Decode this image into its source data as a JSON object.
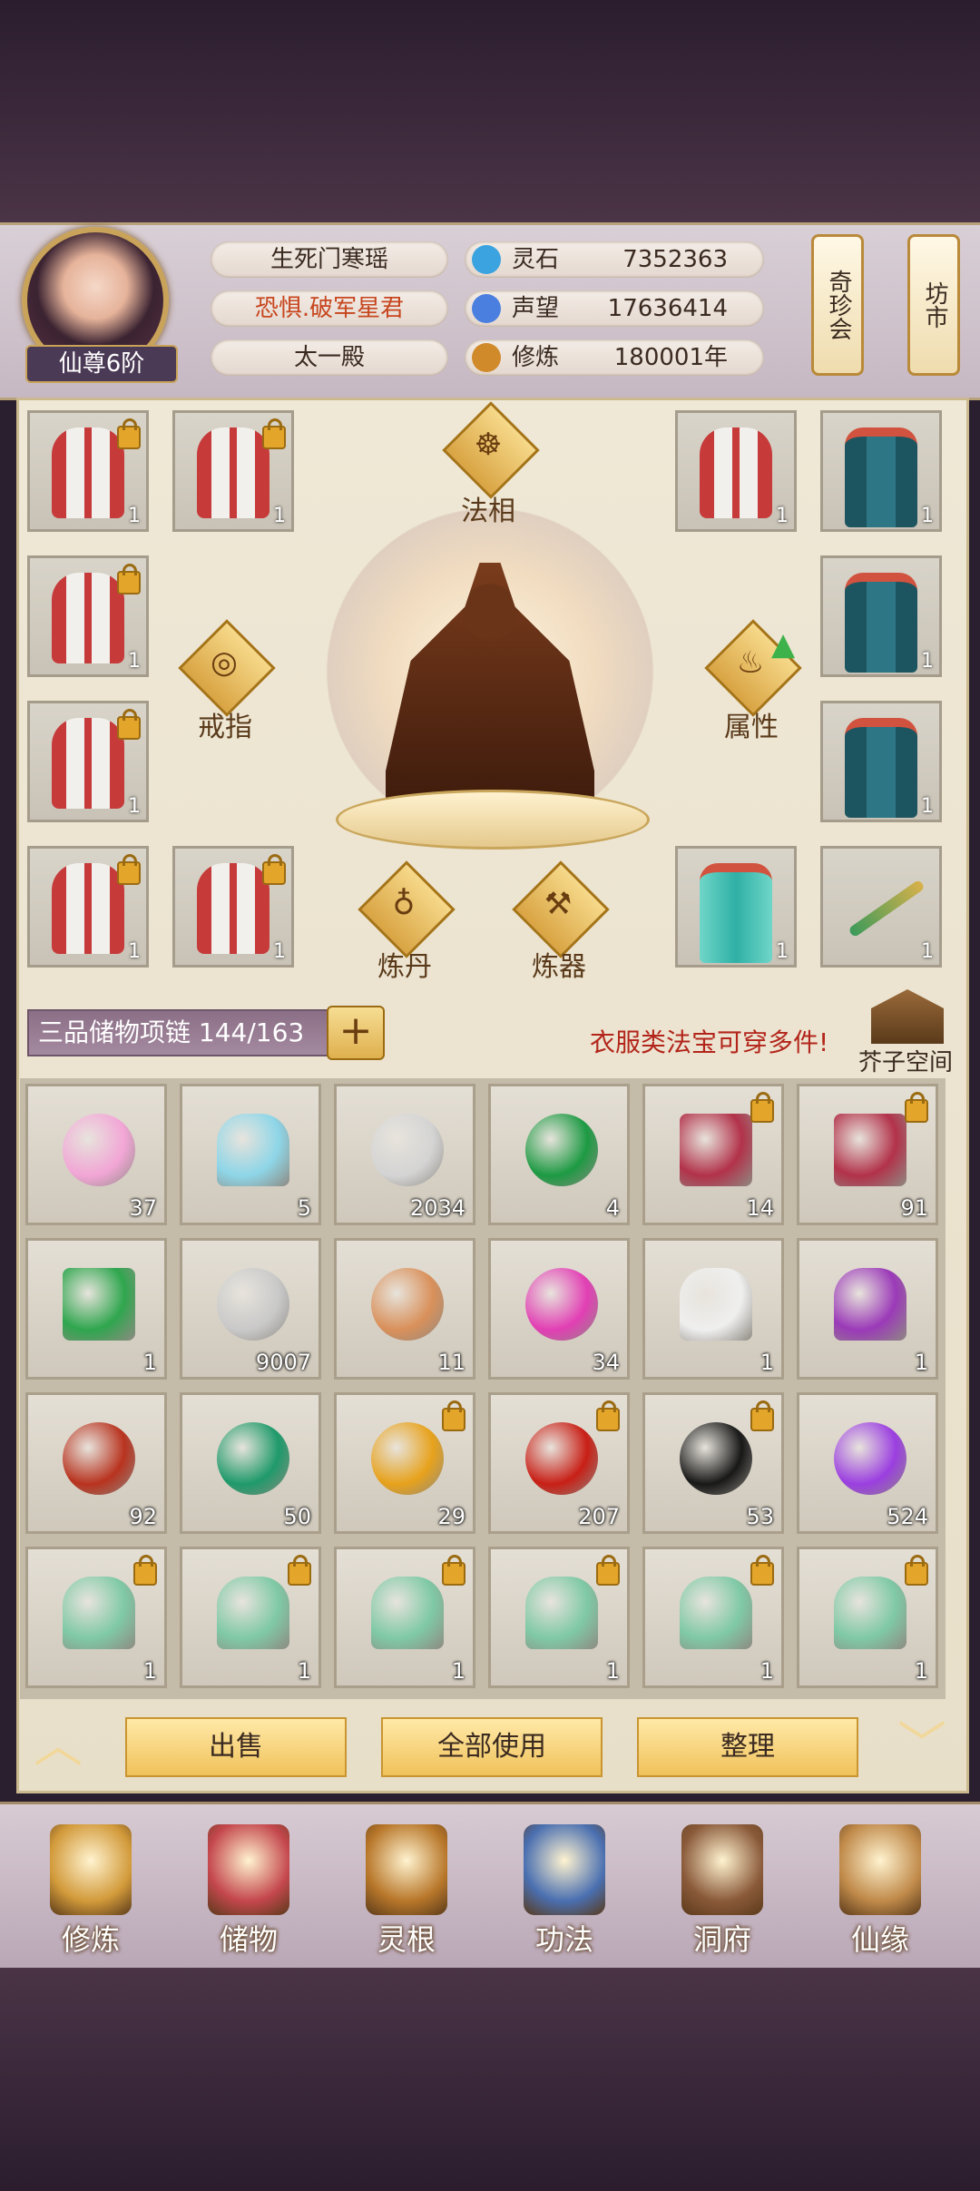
{
  "header": {
    "rank": "仙尊6阶",
    "info_pills": [
      "生死门寒瑶",
      "恐惧.破军星君",
      "太一殿"
    ],
    "stats": [
      {
        "label": "灵石",
        "value": "7352363",
        "icon": "spirit-stone-icon",
        "color": "#3aa3e0"
      },
      {
        "label": "声望",
        "value": "17636414",
        "icon": "reputation-icon",
        "color": "#4a7fe0"
      },
      {
        "label": "修炼",
        "value": "180001年",
        "icon": "meditation-icon",
        "color": "#d08a2a"
      }
    ],
    "side_buttons": [
      "奇珍会",
      "坊市"
    ]
  },
  "equipment": {
    "slots_left": [
      {
        "type": "robe-red",
        "qty": "1",
        "locked": true
      },
      {
        "type": "robe-red",
        "qty": "1",
        "locked": true
      },
      {
        "type": "robe-red",
        "qty": "1",
        "locked": true
      },
      {
        "type": "robe-red",
        "qty": "1",
        "locked": true
      },
      {
        "type": "robe-red",
        "qty": "1",
        "locked": true
      },
      {
        "type": "robe-red",
        "qty": "1",
        "locked": true
      }
    ],
    "slots_right": [
      {
        "type": "robe-red",
        "qty": "1",
        "locked": false
      },
      {
        "type": "robe-teal",
        "qty": "1",
        "locked": false
      },
      {
        "type": "robe-teal",
        "qty": "1",
        "locked": false
      },
      {
        "type": "robe-teal",
        "qty": "1",
        "locked": false
      },
      {
        "type": "armor-teal",
        "qty": "1",
        "locked": false
      },
      {
        "type": "sword",
        "qty": "1",
        "locked": false
      }
    ],
    "center_buttons": {
      "faxiang": "法相",
      "ring": "戒指",
      "attribute": "属性",
      "alchemy": "炼丹",
      "refine": "炼器"
    }
  },
  "storage": {
    "bag_name": "三品储物项链 144/163",
    "hint": "衣服类法宝可穿多件!",
    "mustard_space": "芥子空间",
    "items": [
      {
        "name": "lotus",
        "qty": "37",
        "locked": false,
        "color": "#f2a6d6"
      },
      {
        "name": "spirit-egg",
        "qty": "5",
        "locked": false,
        "color": "#8ed6e8"
      },
      {
        "name": "silver-orb",
        "qty": "2034",
        "locked": false,
        "color": "#d4d4d4"
      },
      {
        "name": "green-orb",
        "qty": "4",
        "locked": false,
        "color": "#1d9a43"
      },
      {
        "name": "rice-box",
        "qty": "14",
        "locked": true,
        "color": "#b2324a"
      },
      {
        "name": "rice-box",
        "qty": "91",
        "locked": true,
        "color": "#b2324a"
      },
      {
        "name": "scroll",
        "qty": "1",
        "locked": false,
        "color": "#2fa64e"
      },
      {
        "name": "silver-token",
        "qty": "9007",
        "locked": false,
        "color": "#c9c9c9"
      },
      {
        "name": "ring",
        "qty": "11",
        "locked": false,
        "color": "#d9905a"
      },
      {
        "name": "pink-flame",
        "qty": "34",
        "locked": false,
        "color": "#e23fb4"
      },
      {
        "name": "white-tree",
        "qty": "1",
        "locked": false,
        "color": "#efefef"
      },
      {
        "name": "purple-tree",
        "qty": "1",
        "locked": false,
        "color": "#9b3ab8"
      },
      {
        "name": "teapot",
        "qty": "92",
        "locked": false,
        "color": "#b8331f"
      },
      {
        "name": "jade-crystal",
        "qty": "50",
        "locked": false,
        "color": "#1f9a6a"
      },
      {
        "name": "gold-orb",
        "qty": "29",
        "locked": true,
        "color": "#e7a21c"
      },
      {
        "name": "red-orb",
        "qty": "207",
        "locked": true,
        "color": "#c81f16"
      },
      {
        "name": "black-orb",
        "qty": "53",
        "locked": true,
        "color": "#181818"
      },
      {
        "name": "purple-crystal",
        "qty": "524",
        "locked": false,
        "color": "#9b3fe0"
      },
      {
        "name": "jade-spirit",
        "qty": "1",
        "locked": true,
        "color": "#7fc9a6"
      },
      {
        "name": "jade-spirit",
        "qty": "1",
        "locked": true,
        "color": "#7fc9a6"
      },
      {
        "name": "jade-spirit",
        "qty": "1",
        "locked": true,
        "color": "#7fc9a6"
      },
      {
        "name": "jade-spirit",
        "qty": "1",
        "locked": true,
        "color": "#7fc9a6"
      },
      {
        "name": "jade-spirit",
        "qty": "1",
        "locked": true,
        "color": "#7fc9a6"
      },
      {
        "name": "jade-spirit",
        "qty": "1",
        "locked": true,
        "color": "#7fc9a6"
      }
    ],
    "actions": {
      "sell": "出售",
      "use_all": "全部使用",
      "sort": "整理"
    }
  },
  "nav": [
    {
      "label": "修炼",
      "icon": "cultivate-icon",
      "color": "#d29a3a"
    },
    {
      "label": "储物",
      "icon": "storage-bag-icon",
      "color": "#c4474d"
    },
    {
      "label": "灵根",
      "icon": "spirit-root-icon",
      "color": "#b8772a"
    },
    {
      "label": "功法",
      "icon": "technique-book-icon",
      "color": "#4a6fb0"
    },
    {
      "label": "洞府",
      "icon": "cave-mansion-icon",
      "color": "#8a5a3a"
    },
    {
      "label": "仙缘",
      "icon": "gourd-icon",
      "color": "#c08a4a"
    }
  ]
}
